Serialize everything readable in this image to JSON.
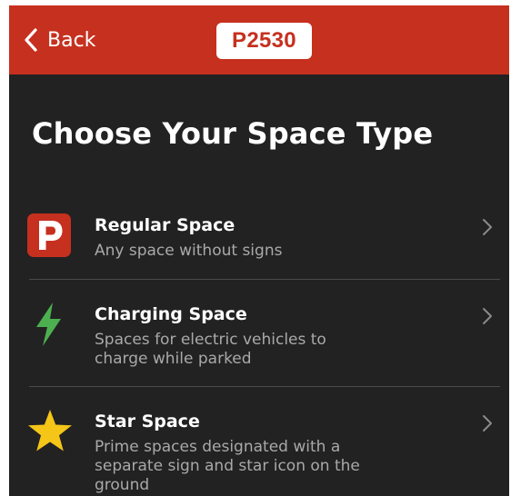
{
  "nav": {
    "back_label": "Back",
    "zone_badge": "P2530"
  },
  "page": {
    "title": "Choose Your Space Type"
  },
  "options": [
    {
      "title": "Regular Space",
      "description": "Any space without signs",
      "icon": "parking-p-icon",
      "icon_color": "#c6301f"
    },
    {
      "title": "Charging Space",
      "description": "Spaces for electric vehicles to charge while parked",
      "icon": "lightning-bolt-icon",
      "icon_color": "#4caf50"
    },
    {
      "title": "Star Space",
      "description": "Prime spaces designated with a separate sign and star icon on the ground",
      "icon": "star-icon",
      "icon_color": "#f5c518"
    }
  ],
  "colors": {
    "brand_red": "#c6301f",
    "background": "#222222",
    "text_primary": "#ffffff",
    "text_secondary": "#a9a9a9"
  }
}
